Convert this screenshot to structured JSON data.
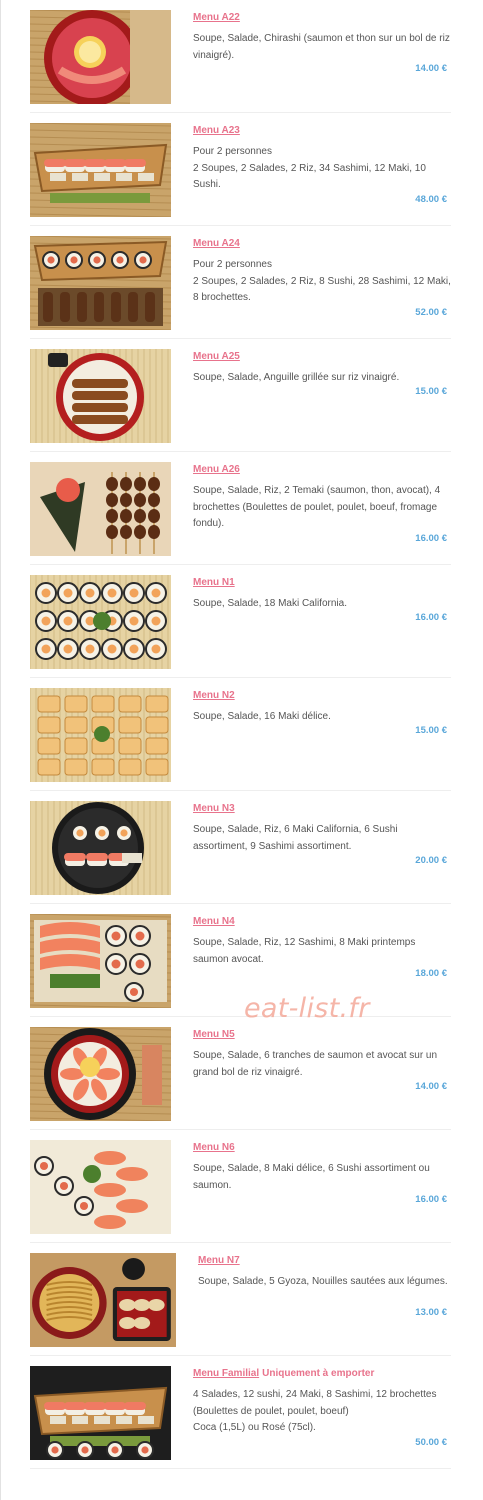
{
  "watermark": "eat-list.fr",
  "menu_items": [
    {
      "title": "Menu A22",
      "lines": [
        "Soupe, Salade, Chirashi (saumon et thon sur un bol de riz vinaigré)."
      ],
      "price": "14.00 €",
      "dish": "chirashi-bowl"
    },
    {
      "title": "Menu A23",
      "lines": [
        "Pour 2 personnes",
        "2 Soupes, 2 Salades, 2 Riz, 34 Sashimi, 12 Maki, 10 Sushi."
      ],
      "price": "48.00 €",
      "dish": "sushi-boat"
    },
    {
      "title": "Menu A24",
      "lines": [
        "Pour 2 personnes",
        "2 Soupes, 2 Salades, 2 Riz, 8 Sushi, 28 Sashimi, 12 Maki, 8 brochettes."
      ],
      "price": "52.00 €",
      "dish": "sushi-boat-skewers"
    },
    {
      "title": "Menu A25",
      "lines": [
        "Soupe, Salade, Anguille grillée sur riz vinaigré."
      ],
      "price": "15.00 €",
      "dish": "eel-bowl"
    },
    {
      "title": "Menu A26",
      "lines": [
        "Soupe, Salade, Riz, 2 Temaki (saumon, thon, avocat), 4 brochettes (Boulettes de poulet, poulet, boeuf, fromage fondu)."
      ],
      "price": "16.00 €",
      "dish": "temaki-skewers"
    },
    {
      "title": "Menu N1",
      "lines": [
        "Soupe, Salade, 18 Maki California."
      ],
      "price": "16.00 €",
      "dish": "maki-california"
    },
    {
      "title": "Menu N2",
      "lines": [
        "Soupe, Salade, 16 Maki délice."
      ],
      "price": "15.00 €",
      "dish": "maki-delice"
    },
    {
      "title": "Menu N3",
      "lines": [
        "Soupe, Salade, Riz, 6 Maki California, 6 Sushi assortiment, 9 Sashimi assortiment."
      ],
      "price": "20.00 €",
      "dish": "mixed-platter"
    },
    {
      "title": "Menu N4",
      "lines": [
        "Soupe, Salade, Riz, 12 Sashimi, 8 Maki printemps saumon avocat."
      ],
      "price": "18.00 €",
      "dish": "sashimi-maki"
    },
    {
      "title": "Menu N5",
      "lines": [
        "Soupe, Salade, 6 tranches de saumon et avocat sur un grand bol de riz vinaigré."
      ],
      "price": "14.00 €",
      "dish": "salmon-bowl"
    },
    {
      "title": "Menu N6",
      "lines": [
        "Soupe, Salade, 8 Maki délice, 6 Sushi assortiment ou saumon."
      ],
      "price": "16.00 €",
      "dish": "sushi-maki-plate"
    },
    {
      "title": "Menu N7",
      "lines": [
        "Soupe, Salade, 5 Gyoza, Nouilles sautées aux légumes."
      ],
      "price": "13.00 €",
      "dish": "gyoza-noodles"
    },
    {
      "title": "Menu Familial",
      "title_suffix": " Uniquement à emporter",
      "lines": [
        "4 Salades, 12 sushi, 24 Maki, 8 Sashimi, 12 brochettes (Boulettes de poulet, poulet, boeuf)",
        "Coca (1,5L) ou Rosé (75cl)."
      ],
      "price": "50.00 €",
      "dish": "family-boat"
    }
  ]
}
